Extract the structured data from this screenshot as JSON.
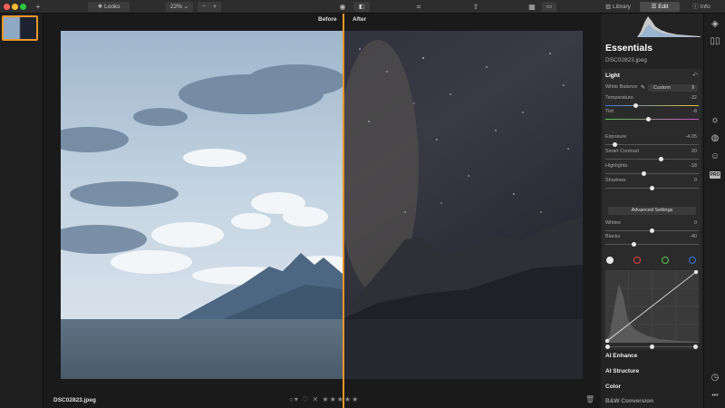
{
  "toolbar": {
    "add_icon": "+",
    "looks_label": "Looks",
    "zoom": "22%",
    "zoom_minus": "−",
    "zoom_plus": "+",
    "tabs": [
      {
        "label": "Library",
        "active": false
      },
      {
        "label": "Edit",
        "active": true
      },
      {
        "label": "Info",
        "active": false
      }
    ]
  },
  "canvas": {
    "before_label": "Before",
    "after_label": "After",
    "file_name": "DSC02823.jpeg",
    "stars": "★★★★★",
    "reject": "✕"
  },
  "panel": {
    "title": "Essentials",
    "file_name": "DSC02823.jpeg",
    "light": {
      "title": "Light",
      "reset_icon": "↶",
      "white_balance_label": "White Balance",
      "white_balance_value": "Custom",
      "sliders": [
        {
          "label": "Temperature",
          "value": "-32",
          "pos": 0.32
        },
        {
          "label": "Tint",
          "value": "-8",
          "pos": 0.46
        },
        {
          "label": "Exposure",
          "value": "-4.05",
          "pos": 0.08
        },
        {
          "label": "Smart Contrast",
          "value": "20",
          "pos": 0.6
        },
        {
          "label": "Highlights",
          "value": "-18",
          "pos": 0.41
        },
        {
          "label": "Shadows",
          "value": "0",
          "pos": 0.5
        },
        {
          "label": "Whites",
          "value": "0",
          "pos": 0.5
        },
        {
          "label": "Blacks",
          "value": "-40",
          "pos": 0.3
        }
      ],
      "advanced_settings": "Advanced Settings"
    },
    "sections": [
      "AI Enhance",
      "AI Structure",
      "Color",
      "B&W Conversion"
    ]
  },
  "rail": {
    "pro_badge": "PRO",
    "more": "•••"
  },
  "colors": {
    "accent": "#e8962b",
    "panel_bg": "#232323",
    "curve_white": "#e8e8e8",
    "curve_red": "#e0443e",
    "curve_green": "#5cc453",
    "curve_blue": "#3d7bd9"
  }
}
